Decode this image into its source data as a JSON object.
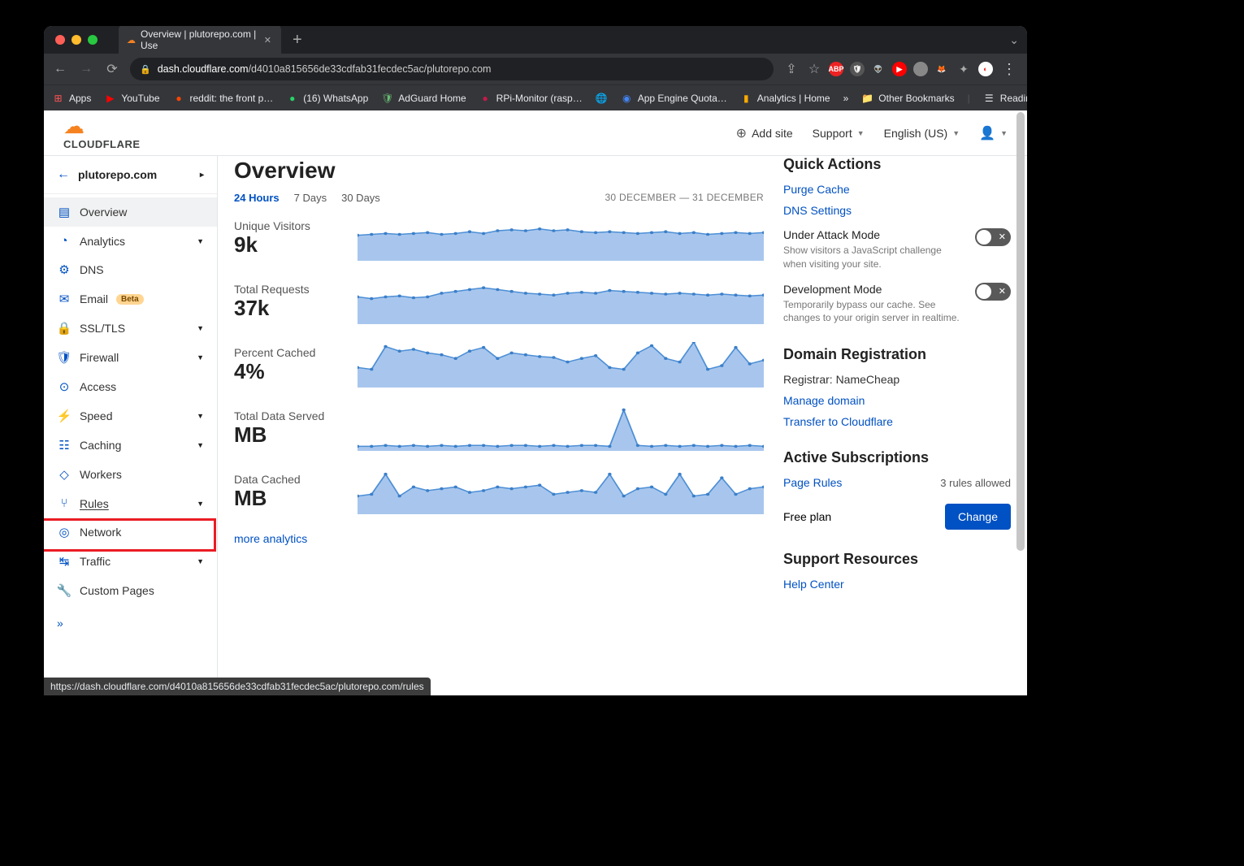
{
  "browser": {
    "tab_title": "Overview | plutorepo.com | Use",
    "url_domain": "dash.cloudflare.com",
    "url_path": "/d4010a815656de33cdfab31fecdec5ac/plutorepo.com",
    "bookmarks": {
      "apps": "Apps",
      "youtube": "YouTube",
      "reddit": "reddit: the front p…",
      "whatsapp": "(16) WhatsApp",
      "adguard": "AdGuard Home",
      "rpi": "RPi-Monitor (rasp…",
      "appengine": "App Engine Quota…",
      "analytics": "Analytics | Home",
      "more": "»",
      "other": "Other Bookmarks",
      "reading": "Reading List"
    },
    "status_url": "https://dash.cloudflare.com/d4010a815656de33cdfab31fecdec5ac/plutorepo.com/rules"
  },
  "header": {
    "logotext": "CLOUDFLARE",
    "add_site": "Add site",
    "support": "Support",
    "language": "English (US)"
  },
  "sidebar": {
    "site": "plutorepo.com",
    "items": [
      {
        "icon": "overview",
        "label": "Overview",
        "active": true
      },
      {
        "icon": "analytics",
        "label": "Analytics",
        "caret": true
      },
      {
        "icon": "dns",
        "label": "DNS"
      },
      {
        "icon": "email",
        "label": "Email",
        "beta": "Beta"
      },
      {
        "icon": "ssl",
        "label": "SSL/TLS",
        "caret": true
      },
      {
        "icon": "firewall",
        "label": "Firewall",
        "caret": true
      },
      {
        "icon": "access",
        "label": "Access"
      },
      {
        "icon": "speed",
        "label": "Speed",
        "caret": true
      },
      {
        "icon": "caching",
        "label": "Caching",
        "caret": true
      },
      {
        "icon": "workers",
        "label": "Workers"
      },
      {
        "icon": "rules",
        "label": "Rules",
        "caret": true,
        "highlight": true
      },
      {
        "icon": "network",
        "label": "Network"
      },
      {
        "icon": "traffic",
        "label": "Traffic",
        "caret": true
      },
      {
        "icon": "custom",
        "label": "Custom Pages"
      }
    ]
  },
  "overview": {
    "title": "Overview",
    "tabs": {
      "t24": "24 Hours",
      "t7": "7 Days",
      "t30": "30 Days"
    },
    "date_range": "30 DECEMBER — 31 DECEMBER",
    "metrics": [
      {
        "label": "Unique Visitors",
        "value": "9k"
      },
      {
        "label": "Total Requests",
        "value": "37k"
      },
      {
        "label": "Percent Cached",
        "value": "4%"
      },
      {
        "label": "Total Data Served",
        "value": "MB"
      },
      {
        "label": "Data Cached",
        "value": "MB"
      }
    ],
    "more_link": "more analytics"
  },
  "quick_actions": {
    "title": "Quick Actions",
    "purge": "Purge Cache",
    "dns": "DNS Settings",
    "under_attack_title": "Under Attack Mode",
    "under_attack_desc": "Show visitors a JavaScript challenge when visiting your site.",
    "dev_mode_title": "Development Mode",
    "dev_mode_desc": "Temporarily bypass our cache. See changes to your origin server in realtime."
  },
  "domain_reg": {
    "title": "Domain Registration",
    "registrar": "Registrar: NameCheap",
    "manage": "Manage domain",
    "transfer": "Transfer to Cloudflare"
  },
  "subscriptions": {
    "title": "Active Subscriptions",
    "page_rules": "Page Rules",
    "rules_allowed": "3 rules allowed",
    "plan": "Free plan",
    "change": "Change"
  },
  "support_resources": {
    "title": "Support Resources",
    "help": "Help Center"
  },
  "chart_data": [
    {
      "type": "area",
      "name": "Unique Visitors",
      "points": [
        28,
        29,
        30,
        29,
        30,
        31,
        29,
        30,
        32,
        30,
        33,
        34,
        33,
        35,
        33,
        34,
        32,
        31,
        32,
        31,
        30,
        31,
        32,
        30,
        31,
        29,
        30,
        31,
        30,
        31
      ]
    },
    {
      "type": "area",
      "name": "Total Requests",
      "points": [
        30,
        28,
        30,
        31,
        29,
        30,
        34,
        36,
        38,
        40,
        38,
        36,
        34,
        33,
        32,
        34,
        35,
        34,
        37,
        36,
        35,
        34,
        33,
        34,
        33,
        32,
        33,
        32,
        31,
        32
      ]
    },
    {
      "type": "area",
      "name": "Percent Cached",
      "points": [
        22,
        20,
        45,
        40,
        42,
        38,
        36,
        32,
        40,
        44,
        32,
        38,
        36,
        34,
        33,
        28,
        32,
        35,
        22,
        20,
        38,
        46,
        32,
        28,
        50,
        20,
        24,
        44,
        26,
        30
      ]
    },
    {
      "type": "area",
      "name": "Total Data Served",
      "points": [
        5,
        5,
        6,
        5,
        6,
        5,
        6,
        5,
        6,
        6,
        5,
        6,
        6,
        5,
        6,
        5,
        6,
        6,
        5,
        45,
        6,
        5,
        6,
        5,
        6,
        5,
        6,
        5,
        6,
        5
      ]
    },
    {
      "type": "area",
      "name": "Data Cached",
      "points": [
        20,
        22,
        44,
        20,
        30,
        26,
        28,
        30,
        24,
        26,
        30,
        28,
        30,
        32,
        22,
        24,
        26,
        24,
        44,
        20,
        28,
        30,
        22,
        44,
        20,
        22,
        40,
        22,
        28,
        30
      ]
    }
  ]
}
